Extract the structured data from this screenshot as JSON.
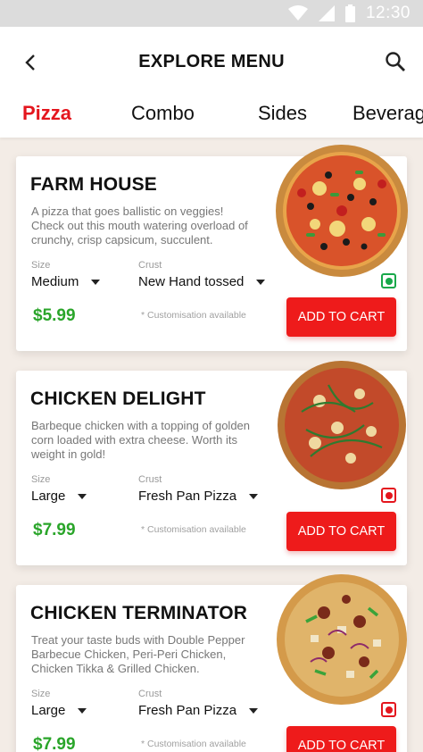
{
  "status": {
    "time": "12:30"
  },
  "header": {
    "title": "EXPLORE MENU"
  },
  "tabs": [
    {
      "label": "Pizza",
      "active": true
    },
    {
      "label": "Combo",
      "active": false
    },
    {
      "label": "Sides",
      "active": false
    },
    {
      "label": "Beverag",
      "active": false
    }
  ],
  "labels": {
    "size": "Size",
    "crust": "Crust",
    "custom_note": "* Customisation available",
    "add_to_cart": "ADD TO CART"
  },
  "colors": {
    "accent": "#e4161e",
    "button": "#ee1b1b",
    "price": "#2aa52a",
    "veg": "#18a84a",
    "nonveg": "#e4161e"
  },
  "items": [
    {
      "name": "FARM HOUSE",
      "description": "A pizza that goes ballistic on veggies! Check out this mouth watering overload of crunchy, crisp capsicum, succulent.",
      "size": "Medium",
      "crust": "New Hand tossed",
      "price": "$5.99",
      "type": "veg"
    },
    {
      "name": "CHICKEN DELIGHT",
      "description": "Barbeque chicken with a topping of golden corn loaded with extra cheese. Worth its weight in gold!",
      "size": "Large",
      "crust": "Fresh Pan Pizza",
      "price": "$7.99",
      "type": "non-veg"
    },
    {
      "name": "CHICKEN TERMINATOR",
      "description": "Treat your taste buds with Double Pepper Barbecue Chicken, Peri-Peri Chicken, Chicken Tikka & Grilled Chicken.",
      "size": "Large",
      "crust": "Fresh Pan Pizza",
      "price": "$7.99",
      "type": "non-veg"
    }
  ]
}
